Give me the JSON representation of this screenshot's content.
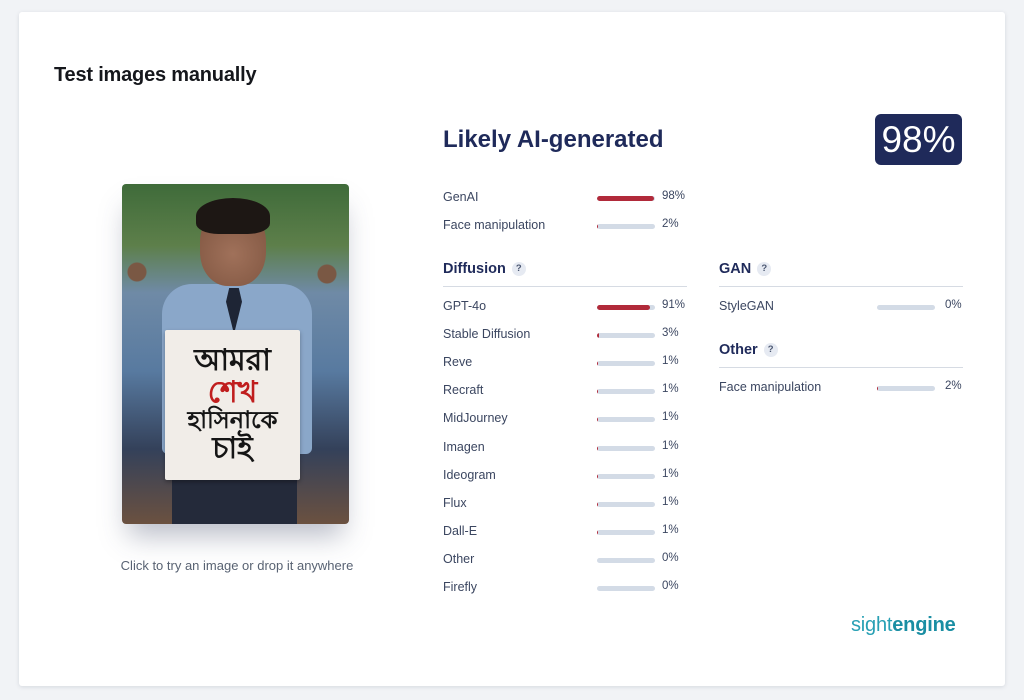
{
  "page": {
    "title": "Test images manually"
  },
  "image_panel": {
    "hint": "Click to try an image or drop it anywhere",
    "sign_lines": [
      "আমরা",
      "শেখ",
      "হাসিনাকে",
      "চাই"
    ]
  },
  "result": {
    "title": "Likely AI-generated",
    "score": "98%",
    "bar_fill_color": "#b12a3a",
    "bar_track_color": "#d3dbe6",
    "badge_color": "#1f2a5a"
  },
  "summary": [
    {
      "label": "GenAI",
      "value": 98,
      "pct": "98%"
    },
    {
      "label": "Face manipulation",
      "value": 2,
      "pct": "2%"
    }
  ],
  "diffusion": {
    "title": "Diffusion",
    "help": "?",
    "items": [
      {
        "label": "GPT-4o",
        "value": 91,
        "pct": "91%"
      },
      {
        "label": "Stable Diffusion",
        "value": 3,
        "pct": "3%"
      },
      {
        "label": "Reve",
        "value": 1,
        "pct": "1%"
      },
      {
        "label": "Recraft",
        "value": 1,
        "pct": "1%"
      },
      {
        "label": "MidJourney",
        "value": 1,
        "pct": "1%"
      },
      {
        "label": "Imagen",
        "value": 1,
        "pct": "1%"
      },
      {
        "label": "Ideogram",
        "value": 1,
        "pct": "1%"
      },
      {
        "label": "Flux",
        "value": 1,
        "pct": "1%"
      },
      {
        "label": "Dall-E",
        "value": 1,
        "pct": "1%"
      },
      {
        "label": "Other",
        "value": 0,
        "pct": "0%"
      },
      {
        "label": "Firefly",
        "value": 0,
        "pct": "0%"
      }
    ]
  },
  "gan": {
    "title": "GAN",
    "help": "?",
    "items": [
      {
        "label": "StyleGAN",
        "value": 0,
        "pct": "0%"
      }
    ]
  },
  "other": {
    "title": "Other",
    "help": "?",
    "items": [
      {
        "label": "Face manipulation",
        "value": 2,
        "pct": "2%"
      }
    ]
  },
  "brand": {
    "part1": "sight",
    "part2": "engine"
  }
}
